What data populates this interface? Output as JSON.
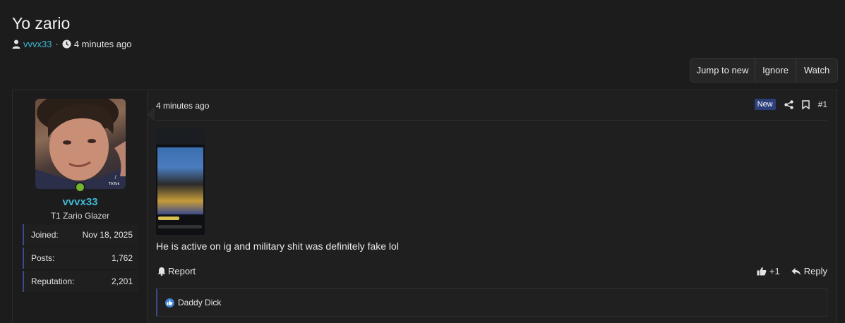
{
  "thread": {
    "title": "Yo zario",
    "author": "vvvx33",
    "separator": "·",
    "time": "4 minutes ago"
  },
  "actions": {
    "jump_to_new": "Jump to new",
    "ignore": "Ignore",
    "watch": "Watch"
  },
  "user": {
    "name": "vvvx33",
    "title": "T1 Zario Glazer",
    "online": true,
    "stats": [
      {
        "label": "Joined:",
        "value": "Nov 18, 2025"
      },
      {
        "label": "Posts:",
        "value": "1,762"
      },
      {
        "label": "Reputation:",
        "value": "2,201"
      }
    ]
  },
  "post": {
    "date": "4 minutes ago",
    "badge": "New",
    "number": "#1",
    "text": "He is active on ig and military shit was definitely fake lol",
    "report_label": "Report",
    "like_count": "+1",
    "reply_label": "Reply",
    "reaction_user": "Daddy Dick"
  },
  "colors": {
    "accent": "#3fb8d3",
    "badge_bg": "#2d3f7a",
    "online": "#73b32f",
    "like_blue": "#3b82d6"
  }
}
